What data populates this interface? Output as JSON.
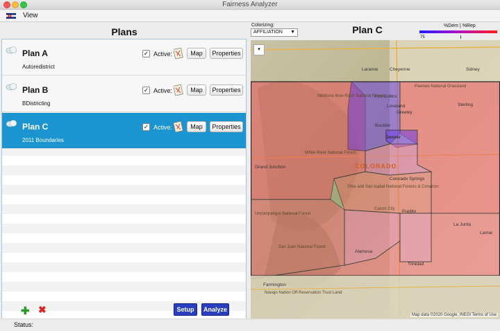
{
  "window": {
    "title": "Fairness Analyzer"
  },
  "menu": {
    "view": "View"
  },
  "plans_panel": {
    "title": "Plans",
    "active_label": "Active:",
    "map_label": "Map",
    "properties_label": "Properties",
    "plans": [
      {
        "name": "Plan A",
        "description": "Autoredistrict",
        "active": true,
        "selected": false
      },
      {
        "name": "Plan B",
        "description": "BDistricting",
        "active": true,
        "selected": false
      },
      {
        "name": "Plan C",
        "description": "2011 Boundaries",
        "active": true,
        "selected": true
      }
    ],
    "add_icon": "plus-icon",
    "remove_icon": "x-icon",
    "setup_label": "Setup",
    "analyze_label": "Analyze"
  },
  "map_panel": {
    "colorizing_label": "Colorizing:",
    "colorizing_value": "AFFILIATION",
    "plan_title": "Plan C",
    "legend_label": "%Dem | %Rep",
    "legend_min": "75",
    "legend_colors": {
      "dem": "#1a1aff",
      "rep": "#ff1a1a"
    },
    "state_label": "COLORADO",
    "cities": [
      "Laramie",
      "Cheyenne",
      "Sidney",
      "Fort Collins",
      "Loveland",
      "Greeley",
      "Boulder",
      "Denver",
      "Colorado Springs",
      "Pueblo",
      "Grand Junction",
      "Alamosa",
      "Trinidad",
      "La Junta",
      "Farmington",
      "Sterling",
      "Lamar"
    ],
    "places": [
      "Pawnee National Grassland",
      "Medicine Bow-Routt National Forests",
      "White River National Forest",
      "Pike and San Isabel National Forests & Cimarron",
      "Uncompahgre National Forest",
      "San Juan National Forest",
      "Navajo Nation Off-Reservation Trust Land",
      "Canon City"
    ],
    "attribution": "Map data ©2020 Google, INEGI   Terms of Use"
  },
  "status": {
    "label": "Status:"
  }
}
